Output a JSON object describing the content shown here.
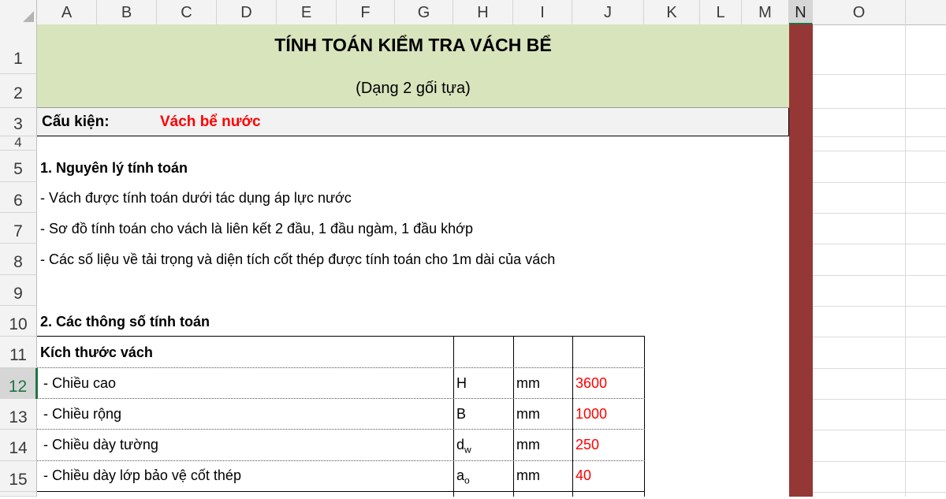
{
  "columns": [
    "A",
    "B",
    "C",
    "D",
    "E",
    "F",
    "G",
    "H",
    "I",
    "J",
    "K",
    "L",
    "M",
    "N",
    "O"
  ],
  "rows": [
    "1",
    "2",
    "3",
    "4",
    "5",
    "6",
    "7",
    "8",
    "9",
    "10",
    "11",
    "12",
    "13",
    "14",
    "15"
  ],
  "active_column": "N",
  "active_row": "12",
  "sheet": {
    "title": "TÍNH TOÁN KIỂM TRA VÁCH BỂ",
    "subtitle": "(Dạng 2 gối tựa)",
    "component_label": "Cấu kiện:",
    "component_value": "Vách bể nước",
    "section1_heading": "1. Nguyên lý tính toán",
    "principles": [
      "- Vách được tính toán dưới tác dụng áp lực nước",
      "- Sơ đồ tính toán cho vách là liên kết 2 đầu, 1 đầu ngàm, 1 đầu khớp",
      "- Các số liệu về tải trọng và diện tích cốt thép được tính toán cho 1m dài của vách"
    ],
    "section2_heading": "2. Các thông số tính toán",
    "table_heading": "Kích thước vách",
    "params": [
      {
        "name": " - Chiều cao",
        "sym": "H",
        "sub": "",
        "unit": "mm",
        "value": "3600"
      },
      {
        "name": " - Chiều rộng",
        "sym": "B",
        "sub": "",
        "unit": "mm",
        "value": "1000"
      },
      {
        "name": " - Chiều dày tường",
        "sym": "d",
        "sub": "w",
        "unit": "mm",
        "value": "250"
      },
      {
        "name": " - Chiều dày lớp bảo vệ cốt thép",
        "sym": "a",
        "sub": "o",
        "unit": "mm",
        "value": "40"
      }
    ]
  },
  "colors": {
    "title_band": "#d8e4bc",
    "component_band": "#f2f2f2",
    "column_n_fill": "#953735",
    "value_red": "#ff0000",
    "header_selected": "#217346"
  }
}
